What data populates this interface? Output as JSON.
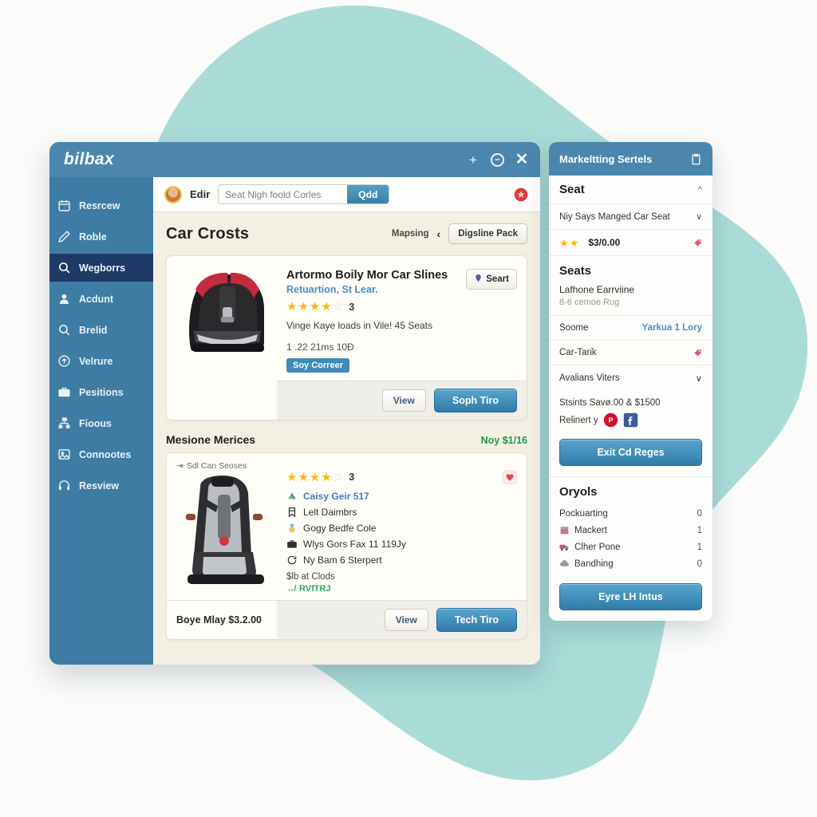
{
  "window": {
    "brand": "bilbax",
    "controls": [
      {
        "name": "add",
        "glyph": "+"
      },
      {
        "name": "minimize",
        "glyph": "−"
      },
      {
        "name": "close",
        "glyph": "✕"
      }
    ]
  },
  "sidebar": {
    "items": [
      {
        "label": "Resrcew",
        "icon": "calendar-icon",
        "active": false
      },
      {
        "label": "Roble",
        "icon": "pen-icon",
        "active": false
      },
      {
        "label": "Wegborrs",
        "icon": "search-icon",
        "active": true
      },
      {
        "label": "Acdunt",
        "icon": "user-icon",
        "active": false
      },
      {
        "label": "Brelid",
        "icon": "search-icon",
        "active": false
      },
      {
        "label": "Velrure",
        "icon": "upload-icon",
        "active": false
      },
      {
        "label": "Pesitions",
        "icon": "briefcase-icon",
        "active": false
      },
      {
        "label": "Fioous",
        "icon": "network-icon",
        "active": false
      },
      {
        "label": "Connootes",
        "icon": "image-icon",
        "active": false
      },
      {
        "label": "Resview",
        "icon": "headset-icon",
        "active": false
      }
    ]
  },
  "topbar": {
    "user": "Edir",
    "search_value": "",
    "search_placeholder": "Seat Nigh foold Corles",
    "search_button": "Qdd",
    "alert_icon": "alert-badge-icon"
  },
  "page": {
    "title": "Car Crosts",
    "breadcrumb": "Mapsing",
    "breadcrumb_chevron": "‹",
    "action_button": "Digsline Pack"
  },
  "product_primary": {
    "title": "Artormo Boily Mor Car Slines",
    "subtitle": "Retuartion, St Lear.",
    "share_button": "Seart",
    "rating": 4,
    "rating_count": "3",
    "description": "Vinge Kaye loads in Vile! 45 Seats",
    "meta": "1  .22 21ms 10Ð",
    "tag": "Soy Correer",
    "view_button": "View",
    "primary_button": "Soph Tiro"
  },
  "section_two": {
    "title": "Mesione Merices",
    "price": "Noy $1/16"
  },
  "product_secondary": {
    "thumb_label": "Sdl Can Seoses",
    "rating": 4,
    "rating_count": "3",
    "features": [
      {
        "label": "Caisy Geir 517",
        "icon": "ribbon-icon",
        "link": true
      },
      {
        "label": "Lelt Daimbrs",
        "icon": "bookmark-icon",
        "link": false
      },
      {
        "label": "Gogy Bedfe Cole",
        "icon": "medal-icon",
        "link": false
      },
      {
        "label": "Wlys Gors Fax 11 119Jy",
        "icon": "briefcase-icon",
        "link": false
      },
      {
        "label": "Ny Bam 6 Sterpert",
        "icon": "refresh-icon",
        "link": false
      }
    ],
    "small_note": "$lb at Clods",
    "green_note": "RVfTRJ",
    "price": "Boye Mlay $3.2.00",
    "view_button": "View",
    "primary_button": "Tech Tiro",
    "wishlist_icon": "wishlist-icon"
  },
  "right_panel": {
    "title": "Markeltting Sertels",
    "head_icon": "clipboard-icon",
    "section_seat": "Seat",
    "section_seat_chevron": "^",
    "dropdown_label": "Niy Says Manged Car Seat",
    "dropdown_chevron": "∨",
    "rating": 2,
    "price": "$3/0.00",
    "price_badge_icon": "tag-icon",
    "section_seats": "Seats",
    "seats_primary": "Lafhone Earrviine",
    "seats_muted": "8-6 cemoe Rug",
    "kv_rows": [
      {
        "label": "Soome",
        "value": "Yarkua 1 Lory",
        "icon": ""
      },
      {
        "label": "Car-Tarik",
        "value": "",
        "icon": "tag-icon"
      }
    ],
    "filters_label": "Avalians Viters",
    "filters_chevron": "∨",
    "savings": "Stsints Savø.00 & $1500",
    "social_label": "Relinert y",
    "socials": [
      "pinterest-icon",
      "facebook-icon"
    ],
    "cta_primary": "Exit Cd Reges",
    "stats_title": "Oryols",
    "stats": [
      {
        "label": "Pockuarting",
        "value": "0",
        "icon": ""
      },
      {
        "label": "Mackert",
        "value": "1",
        "icon": "package-icon"
      },
      {
        "label": "Clher Pone",
        "value": "1",
        "icon": "truck-icon"
      },
      {
        "label": "Bandhing",
        "value": "0",
        "icon": "cloud-icon"
      }
    ],
    "cta_secondary": "Eyre LH Intus"
  },
  "colors": {
    "blob": "#aadcd7",
    "titlebar": "#4a86ad",
    "sidebar": "#3d7ca5",
    "sidebar_active": "#1f3a66",
    "accent_button": "#2f7ca9",
    "star": "#f5b911",
    "green": "#1a9b4e",
    "page_bg": "#f4efe3"
  }
}
